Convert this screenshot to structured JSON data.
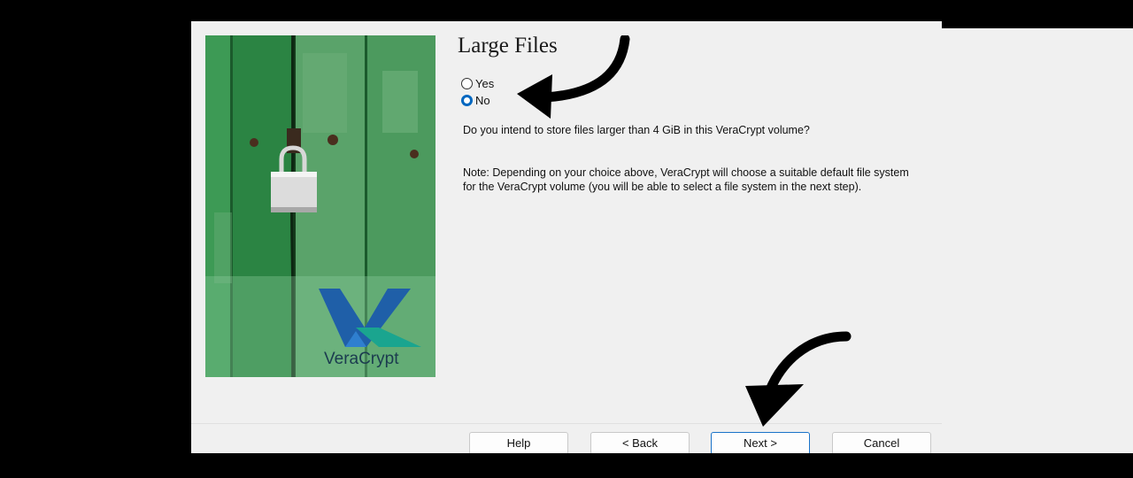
{
  "wizard": {
    "title": "Large Files",
    "options": [
      {
        "label": "Yes",
        "checked": false
      },
      {
        "label": "No",
        "checked": true
      }
    ],
    "question": "Do you intend to store files larger than 4 GiB in this VeraCrypt volume?",
    "note": "Note: Depending on your choice above, VeraCrypt will choose a suitable default file system for the VeraCrypt volume (you will be able to select a file system in the next step).",
    "logo_text": "VeraCrypt"
  },
  "buttons": {
    "help": "Help",
    "back": "< Back",
    "next": "Next >",
    "cancel": "Cancel"
  },
  "colors": {
    "accent": "#0067c0",
    "wood_green": "#2f8a49",
    "logo_blue": "#1f5fa8",
    "logo_teal": "#1aa58f"
  },
  "annotations": [
    "curved-arrow-icon",
    "curved-arrow-icon"
  ]
}
